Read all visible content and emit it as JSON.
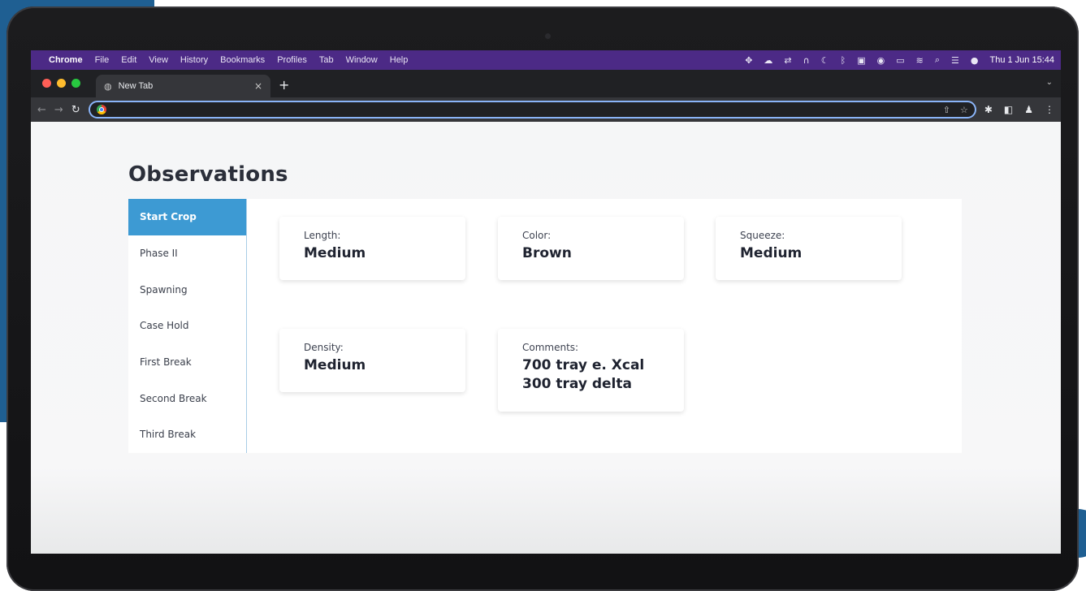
{
  "menubar": {
    "app": "Chrome",
    "items": [
      "File",
      "Edit",
      "View",
      "History",
      "Bookmarks",
      "Profiles",
      "Tab",
      "Window",
      "Help"
    ],
    "clock": "Thu 1 Jun  15:44",
    "tray_icons": [
      "dropbox-icon",
      "creative-cloud-icon",
      "share-icon",
      "headphones-icon",
      "moon-icon",
      "bluetooth-icon",
      "keyboard-icon",
      "record-icon",
      "battery-icon",
      "wifi-icon",
      "search-icon",
      "control-center-icon",
      "siri-icon"
    ],
    "tray_colors": {
      "background": "#4c2a86"
    }
  },
  "tabs": [
    {
      "title": "New Tab",
      "active": true
    }
  ],
  "toolbar": {
    "url": ""
  },
  "page": {
    "title": "Observations",
    "sidebar": [
      {
        "label": "Start Crop",
        "active": true
      },
      {
        "label": "Phase II",
        "active": false
      },
      {
        "label": "Spawning",
        "active": false
      },
      {
        "label": "Case Hold",
        "active": false
      },
      {
        "label": "First Break",
        "active": false
      },
      {
        "label": "Second Break",
        "active": false
      },
      {
        "label": "Third Break",
        "active": false
      }
    ],
    "cards": {
      "length": {
        "label": "Length:",
        "value": "Medium"
      },
      "color": {
        "label": "Color:",
        "value": "Brown"
      },
      "squeeze": {
        "label": "Squeeze:",
        "value": "Medium"
      },
      "density": {
        "label": "Density:",
        "value": "Medium"
      },
      "comments": {
        "label": "Comments:",
        "value": "700 tray e. Xcal\n300 tray delta"
      }
    }
  },
  "theme": {
    "accent": "#3d9ad3",
    "menubar": "#4c2a86",
    "frame": "#1f5f92"
  }
}
